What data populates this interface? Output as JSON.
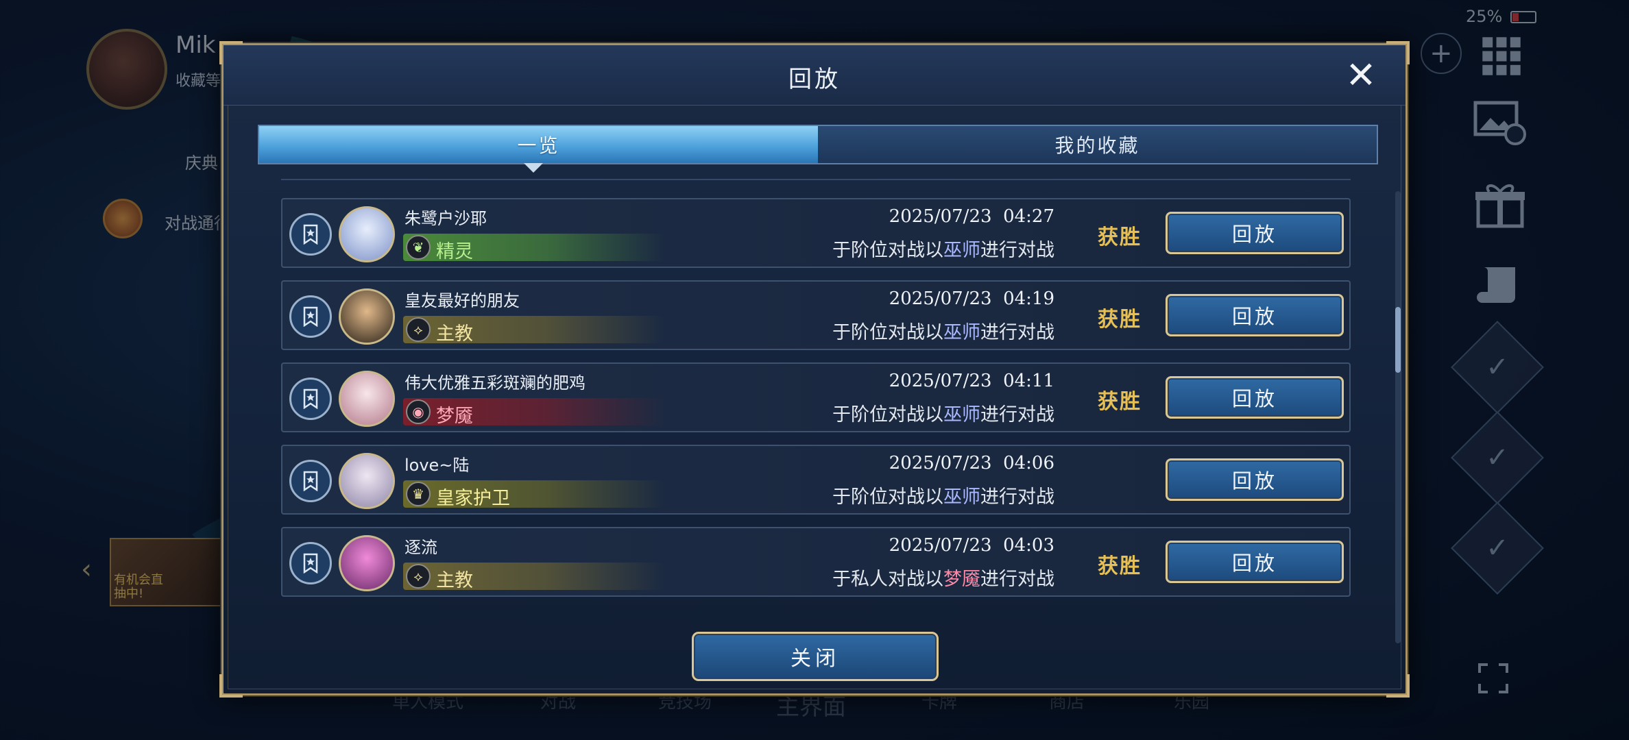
{
  "background": {
    "profile_name": "Mik",
    "profile_sub": "收藏等",
    "side_item_1": "庆典",
    "side_item_2": "对战通行证 第",
    "side_banner_text": "有机会直 抽中!",
    "battery": "25%",
    "bottom_nav": [
      "单人模式",
      "对战",
      "竞技场",
      "主界面",
      "卡牌",
      "商店",
      "乐园"
    ]
  },
  "dialog": {
    "title": "回放",
    "tabs": [
      {
        "label": "一览",
        "active": true
      },
      {
        "label": "我的收藏",
        "active": false
      }
    ],
    "close_button": "关闭"
  },
  "replays": [
    {
      "player": "朱鹭户沙耶",
      "class": "精灵",
      "class_color": "#4a8a3a",
      "class_text_color": "#b9f08f",
      "class_icon": "leaf-icon",
      "date": "2025/07/23",
      "time": "04:27",
      "mode_pre": "于阶位对战以",
      "mode_class": "巫师",
      "mode_post": "进行对战",
      "result": "获胜",
      "button": "回放"
    },
    {
      "player": "皇友最好的朋友",
      "class": "主教",
      "class_color": "#6c6434",
      "class_text_color": "#f1e3a1",
      "class_icon": "bishop-icon",
      "date": "2025/07/23",
      "time": "04:19",
      "mode_pre": "于阶位对战以",
      "mode_class": "巫师",
      "mode_post": "进行对战",
      "result": "获胜",
      "button": "回放"
    },
    {
      "player": "伟大优雅五彩斑斓的肥鸡",
      "class": "梦魇",
      "class_color": "#7a1f2c",
      "class_text_color": "#ffa9b8",
      "class_icon": "nightmare-icon",
      "date": "2025/07/23",
      "time": "04:11",
      "mode_pre": "于阶位对战以",
      "mode_class": "巫师",
      "mode_post": "进行对战",
      "result": "获胜",
      "button": "回放"
    },
    {
      "player": "love~陆",
      "class": "皇家护卫",
      "class_color": "#6a6a2a",
      "class_text_color": "#f5ee9a",
      "class_icon": "crown-icon",
      "date": "2025/07/23",
      "time": "04:06",
      "mode_pre": "于阶位对战以",
      "mode_class": "巫师",
      "mode_post": "进行对战",
      "result": "",
      "button": "回放"
    },
    {
      "player": "逐流",
      "class": "主教",
      "class_color": "#6c6434",
      "class_text_color": "#f1e3a1",
      "class_icon": "bishop-icon",
      "date": "2025/07/23",
      "time": "04:03",
      "mode_pre": "于私人对战以",
      "mode_class": "梦魇",
      "mode_post": "进行对战",
      "result": "获胜",
      "button": "回放"
    }
  ],
  "scroll": {
    "position_fraction": 0.3
  }
}
